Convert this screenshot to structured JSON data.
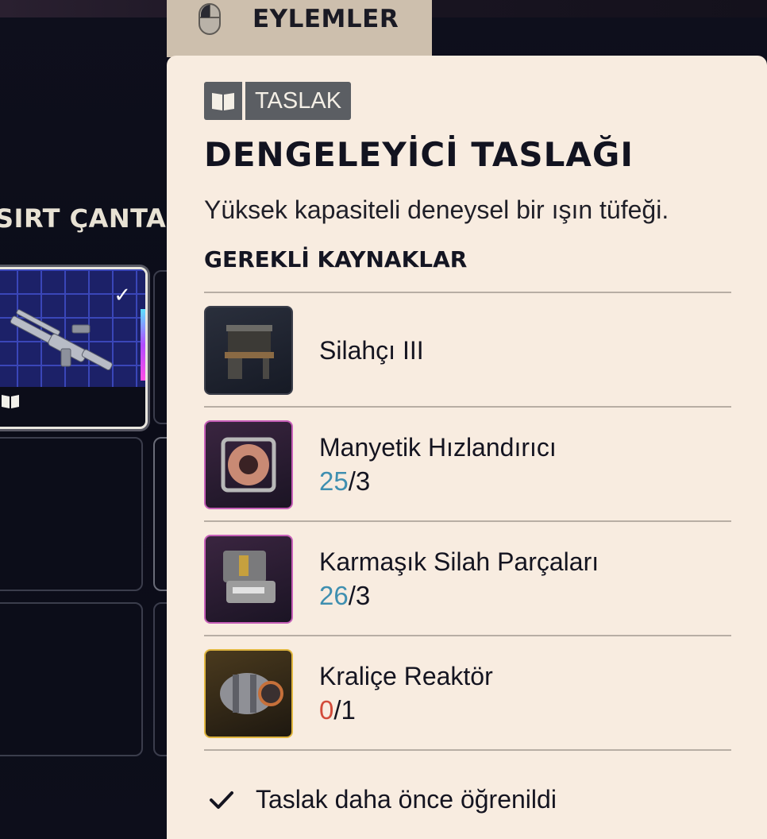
{
  "window": {
    "actions_tab": {
      "label": "EYLEMLER",
      "icon": "mouse-icon"
    }
  },
  "inventory": {
    "section_title": "SIRT ÇANTASI",
    "selected_slot": {
      "check_icon": "checkmark-icon",
      "type_icon": "book-icon"
    }
  },
  "tooltip": {
    "tag": {
      "icon": "book-icon",
      "label": "TASLAK"
    },
    "title": "DENGELEYİCİ TASLAĞI",
    "description": "Yüksek kapasiteli deneysel bir ışın tüfeği.",
    "requirements_header": "GEREKLİ KAYNAKLAR",
    "resources": [
      {
        "name": "Silahçı III",
        "have": "",
        "need": "",
        "sep": "",
        "rarity_color": "#3c3f4b"
      },
      {
        "name": "Manyetik Hızlandırıcı",
        "have": "25",
        "need": "3",
        "sep": "/",
        "rarity_color": "#c65fb8"
      },
      {
        "name": "Karmaşık Silah Parçaları",
        "have": "26",
        "need": "3",
        "sep": "/",
        "rarity_color": "#c65fb8"
      },
      {
        "name": "Kraliçe Reaktör",
        "have": "0",
        "need": "1",
        "sep": "/",
        "rarity_color": "#e0b640"
      }
    ],
    "footer": {
      "icon": "checkmark-icon",
      "text": "Taslak daha önce öğrenildi"
    }
  },
  "colors": {
    "panel_bg": "#f8ece0",
    "qty_ok": "#3f8fb0",
    "qty_lack": "#d24b3a"
  }
}
